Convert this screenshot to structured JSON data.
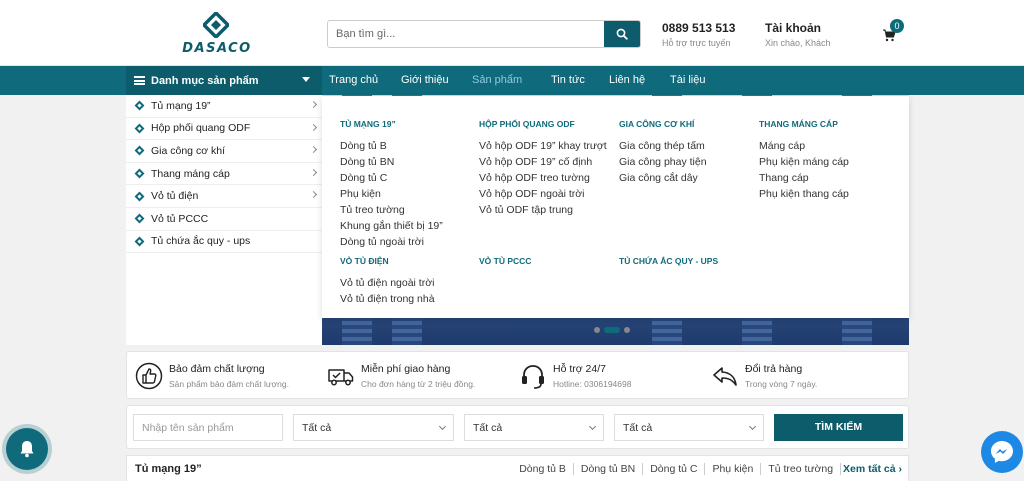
{
  "header": {
    "logo_text": "DASACO",
    "search_placeholder": "Bạn tìm gì...",
    "hotline_number": "0889 513 513",
    "hotline_sub": "Hỗ trợ trực tuyến",
    "account_title": "Tài khoản",
    "account_sub": "Xin chào, Khách",
    "cart_count": "0"
  },
  "nav": {
    "category_toggle": "Danh mục sản phẩm",
    "items": [
      {
        "label": "Trang chủ",
        "active": false
      },
      {
        "label": "Giới thiệu",
        "active": false
      },
      {
        "label": "Sản phẩm",
        "active": true
      },
      {
        "label": "Tin tức",
        "active": false
      },
      {
        "label": "Liên hệ",
        "active": false
      },
      {
        "label": "Tài liệu",
        "active": false
      }
    ]
  },
  "sidebar": {
    "items": [
      {
        "label": "Tủ mạng 19”",
        "has_sub": true
      },
      {
        "label": "Hộp phối quang ODF",
        "has_sub": true
      },
      {
        "label": "Gia công cơ khí",
        "has_sub": true
      },
      {
        "label": "Thang máng cáp",
        "has_sub": true
      },
      {
        "label": "Vỏ tủ điện",
        "has_sub": true
      },
      {
        "label": "Vỏ tủ PCCC",
        "has_sub": false
      },
      {
        "label": "Tủ chứa ắc quy - ups",
        "has_sub": false
      }
    ]
  },
  "mega": {
    "col1": {
      "heading": "TỦ MẠNG 19”",
      "links": [
        "Dòng tủ B",
        "Dòng tủ BN",
        "Dòng tủ C",
        "Phụ kiện",
        "Tủ treo tường",
        "Khung gắn thiết bị 19”",
        "Dòng tủ ngoài trời"
      ]
    },
    "col2": {
      "heading": "HỘP PHỐI QUANG ODF",
      "links": [
        "Vỏ hộp ODF 19” khay trượt",
        "Vỏ hộp ODF 19” cố định",
        "Vỏ hộp ODF treo tường",
        "Vỏ hộp ODF ngoài trời",
        "Vỏ tủ ODF tập trung"
      ]
    },
    "col3": {
      "heading": "GIA CÔNG CƠ KHÍ",
      "links": [
        "Gia công thép tấm",
        "Gia công phay tiện",
        "Gia công cắt dây"
      ]
    },
    "col4": {
      "heading": "THANG MÁNG CÁP",
      "links": [
        "Máng cáp",
        "Phụ kiện máng cáp",
        "Thang cáp",
        "Phụ kiện thang cáp"
      ]
    },
    "col5": {
      "heading": "VỎ TỦ ĐIỆN",
      "links": [
        "Vỏ tủ điện ngoài trời",
        "Vỏ tủ điện trong nhà"
      ]
    },
    "col6": {
      "heading": "VỎ TỦ PCCC",
      "links": []
    },
    "col7": {
      "heading": "TỦ CHỨA ẮC QUY - UPS",
      "links": []
    }
  },
  "features": [
    {
      "title": "Bảo đảm chất lượng",
      "sub": "Sản phẩm bảo đảm chất lượng.",
      "icon": "thumbs-up-icon"
    },
    {
      "title": "Miễn phí giao hàng",
      "sub": "Cho đơn hàng từ 2 triệu đồng.",
      "icon": "truck-icon"
    },
    {
      "title": "Hỗ trợ 24/7",
      "sub": "Hotline: 0306194698",
      "icon": "headset-icon"
    },
    {
      "title": "Đổi trả hàng",
      "sub": "Trong vòng 7 ngày.",
      "icon": "return-arrow-icon"
    }
  ],
  "filter": {
    "name_placeholder": "Nhập tên sản phẩm",
    "select1": "Tất cả",
    "select2": "Tất cả",
    "select3": "Tất cả",
    "button": "TÌM KIẾM"
  },
  "section": {
    "title": "Tủ mạng 19”",
    "links": [
      "Dòng tủ B",
      "Dòng tủ BN",
      "Dòng tủ C",
      "Phụ kiện",
      "Tủ treo tường"
    ],
    "more": "Xem tất cả"
  },
  "colors": {
    "primary": "#0f6b7b",
    "primary_dark": "#0d5c6b",
    "messenger": "#1e88e5"
  }
}
